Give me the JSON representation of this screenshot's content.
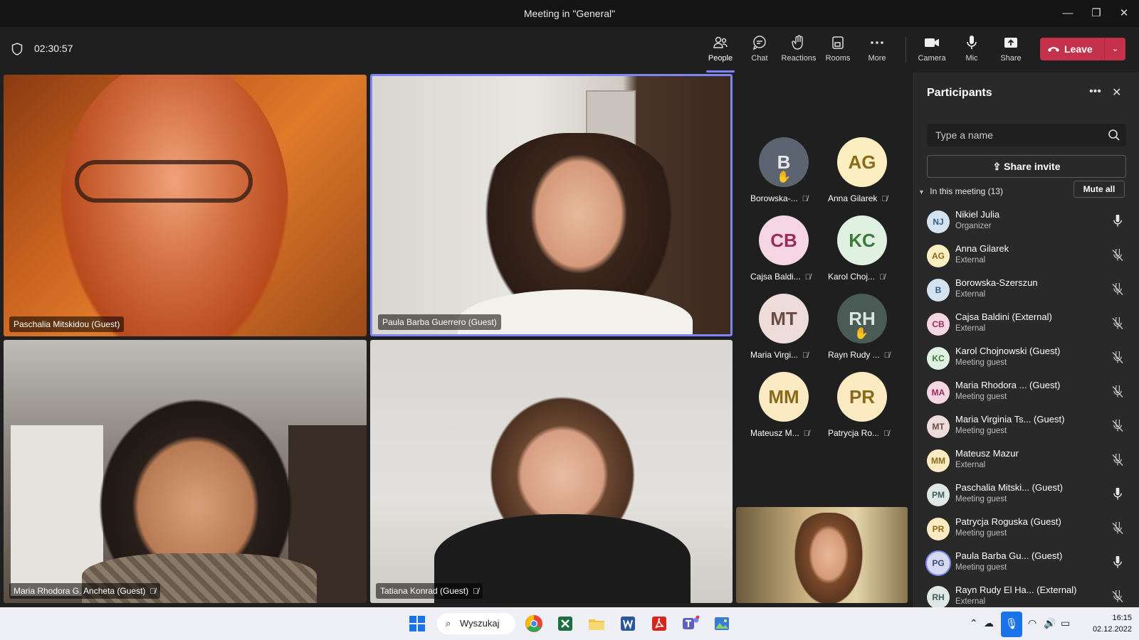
{
  "window": {
    "title": "Meeting in \"General\"",
    "minimize": "—",
    "maximize": "❐",
    "close": "✕"
  },
  "toolbar": {
    "timer": "02:30:57",
    "buttons": [
      {
        "label": "People",
        "icon": "people-icon"
      },
      {
        "label": "Chat",
        "icon": "chat-icon"
      },
      {
        "label": "Reactions",
        "icon": "reactions-icon"
      },
      {
        "label": "Rooms",
        "icon": "rooms-icon"
      },
      {
        "label": "More",
        "icon": "more-icon"
      },
      {
        "label": "Camera",
        "icon": "camera-icon"
      },
      {
        "label": "Mic",
        "icon": "mic-icon"
      },
      {
        "label": "Share",
        "icon": "share-icon"
      }
    ],
    "leave_label": "Leave",
    "leave_color": "#c4314b",
    "accent": "#7f85f5"
  },
  "videos": [
    {
      "name": "Paschalia Mitskidou (Guest)",
      "muted": false
    },
    {
      "name": "Paula Barba Guerrero (Guest)",
      "muted": false
    },
    {
      "name": "Maria Rhodora G. Ancheta (Guest)",
      "muted": true
    },
    {
      "name": "Tatiana Konrad (Guest)",
      "muted": true
    }
  ],
  "avatars": [
    {
      "initials": "B",
      "label": "Borowska-...",
      "bg": "#5b6470",
      "fg": "#e8e8e8",
      "hand": true
    },
    {
      "initials": "AG",
      "label": "Anna Gilarek",
      "bg": "#fbefc2",
      "fg": "#8a6a1a",
      "hand": false
    },
    {
      "initials": "CB",
      "label": "Cajsa Baldi...",
      "bg": "#f6d6e3",
      "fg": "#9b2c5a",
      "hand": false
    },
    {
      "initials": "KC",
      "label": "Karol Choj...",
      "bg": "#e1f1e1",
      "fg": "#3b7a3b",
      "hand": false
    },
    {
      "initials": "MT",
      "label": "Maria Virgi...",
      "bg": "#eddcd9",
      "fg": "#6a4a44",
      "hand": false
    },
    {
      "initials": "RH",
      "label": "Rayn Rudy ...",
      "bg": "#4a5a55",
      "fg": "#d9e6e0",
      "hand": true
    },
    {
      "initials": "MM",
      "label": "Mateusz M...",
      "bg": "#fbeac2",
      "fg": "#8a6a1a",
      "hand": false
    },
    {
      "initials": "PR",
      "label": "Patrycja Ro...",
      "bg": "#fbeac2",
      "fg": "#8a6a1a",
      "hand": false
    }
  ],
  "panel": {
    "title": "Participants",
    "search_placeholder": "Type a name",
    "share_invite": "Share invite",
    "in_meeting": "In this meeting (13)",
    "mute_all": "Mute all",
    "participants": [
      {
        "initials": "NJ",
        "name": "Nikiel Julia",
        "role": "Organizer",
        "mic": "on",
        "bg": "#d5e3f0",
        "fg": "#2f5f8a"
      },
      {
        "initials": "AG",
        "name": "Anna Gilarek",
        "role": "External",
        "mic": "off",
        "bg": "#fbefc2",
        "fg": "#8a6a1a"
      },
      {
        "initials": "B",
        "name": "Borowska-Szerszun",
        "role": "External",
        "mic": "off",
        "bg": "#d5e3f0",
        "fg": "#2f5f8a"
      },
      {
        "initials": "CB",
        "name": "Cajsa Baldini (External)",
        "role": "External",
        "mic": "off",
        "bg": "#f6d6e3",
        "fg": "#9b2c5a"
      },
      {
        "initials": "KC",
        "name": "Karol Chojnowski (Guest)",
        "role": "Meeting guest",
        "mic": "off",
        "bg": "#e1f1e1",
        "fg": "#3b7a3b"
      },
      {
        "initials": "MA",
        "name": "Maria Rhodora ...   (Guest)",
        "role": "Meeting guest",
        "mic": "off",
        "bg": "#f6d6e3",
        "fg": "#9b2c5a"
      },
      {
        "initials": "MT",
        "name": "Maria Virginia Ts... (Guest)",
        "role": "Meeting guest",
        "mic": "off",
        "bg": "#eddcd9",
        "fg": "#6a4a44"
      },
      {
        "initials": "MM",
        "name": "Mateusz Mazur",
        "role": "External",
        "mic": "off",
        "bg": "#fbeac2",
        "fg": "#8a6a1a"
      },
      {
        "initials": "PM",
        "name": "Paschalia Mitski...  (Guest)",
        "role": "Meeting guest",
        "mic": "on",
        "bg": "#dfe8e6",
        "fg": "#3d5e58"
      },
      {
        "initials": "PR",
        "name": "Patrycja Roguska (Guest)",
        "role": "Meeting guest",
        "mic": "off",
        "bg": "#fbeac2",
        "fg": "#8a6a1a"
      },
      {
        "initials": "PG",
        "name": "Paula Barba Gu...  (Guest)",
        "role": "Meeting guest",
        "mic": "on",
        "bg": "#d5daf0",
        "fg": "#3a4a8a"
      },
      {
        "initials": "RH",
        "name": "Rayn Rudy El Ha...  (External)",
        "role": "External",
        "mic": "off",
        "bg": "#dfe8e6",
        "fg": "#3d5e58"
      }
    ]
  },
  "taskbar": {
    "search_label": "Wyszukaj",
    "time": "16:15",
    "date": "02.12.2022"
  }
}
